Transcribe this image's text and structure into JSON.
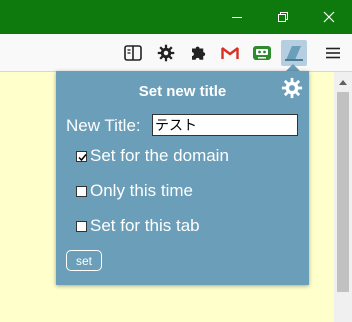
{
  "window": {
    "buttons": [
      "minimize",
      "restore",
      "close"
    ]
  },
  "toolbar": {
    "icons": [
      "reader-icon",
      "gear-icon",
      "puzzle-icon",
      "gmail-icon",
      "robot-icon",
      "title-extension-icon",
      "menu-icon"
    ]
  },
  "popup": {
    "heading": "Set new title",
    "new_title_label": "New Title:",
    "new_title_value": "テスト",
    "options": [
      {
        "label": "Set for the domain",
        "checked": true
      },
      {
        "label": "Only this time",
        "checked": false
      },
      {
        "label": "Set for this tab",
        "checked": false
      }
    ],
    "set_label": "set"
  },
  "colors": {
    "titlebar": "#0e7a0d",
    "popup_bg": "#6b9eb8",
    "page_bg": "#ffffcc",
    "gmail_red": "#d93025",
    "robot_green": "#2e8b2e"
  }
}
